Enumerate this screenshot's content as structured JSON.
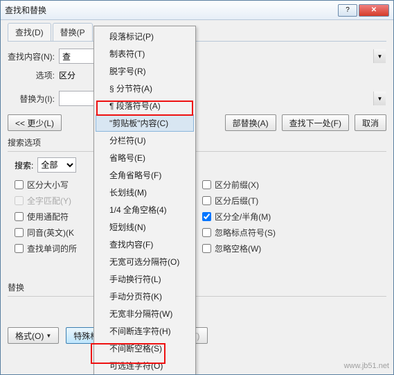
{
  "window": {
    "title": "查找和替换"
  },
  "titlebar": {
    "help": "?",
    "close": "✕"
  },
  "tabs": {
    "find": "查找(D)",
    "replace": "替换(P"
  },
  "fields": {
    "find_label": "查找内容(N):",
    "find_value": "查",
    "options_label": "选项:",
    "options_value": "区分",
    "replace_label": "替换为(I):",
    "replace_value": ""
  },
  "buttons": {
    "less": "<<  更少(L)",
    "replace_all": "部替换(A)",
    "find_next": "查找下一处(F)",
    "cancel": "取消",
    "format": "格式(O)",
    "special": "特殊格式(E)",
    "noformat": "不限定格式(T)"
  },
  "search_section": {
    "title": "搜索选项",
    "search_label": "搜索:",
    "search_value": "全部"
  },
  "checks_left": {
    "c1": "区分大小写",
    "c2": "全字匹配(Y)",
    "c3": "使用通配符",
    "c4": "同音(英文)(K",
    "c5": "查找单词的所"
  },
  "checks_right": {
    "c1": "区分前缀(X)",
    "c2": "区分后缀(T)",
    "c3": "区分全/半角(M)",
    "c4": "忽略标点符号(S)",
    "c5": "忽略空格(W)"
  },
  "replace_section": {
    "title": "替换"
  },
  "menu": {
    "m1": "段落标记(P)",
    "m2": "制表符(T)",
    "m3": "脱字号(R)",
    "m4": "§ 分节符(A)",
    "m5": "¶ 段落符号(A)",
    "m6": "\"剪贴板\"内容(C)",
    "m7": "分栏符(U)",
    "m8": "省略号(E)",
    "m9": "全角省略号(F)",
    "m10": "长划线(M)",
    "m11": "1/4 全角空格(4)",
    "m12": "短划线(N)",
    "m13": "查找内容(F)",
    "m14": "无宽可选分隔符(O)",
    "m15": "手动换行符(L)",
    "m16": "手动分页符(K)",
    "m17": "无宽非分隔符(W)",
    "m18": "不间断连字符(H)",
    "m19": "不间断空格(S)",
    "m20": "可选连字符(O)"
  },
  "watermark": "www.jb51.net"
}
